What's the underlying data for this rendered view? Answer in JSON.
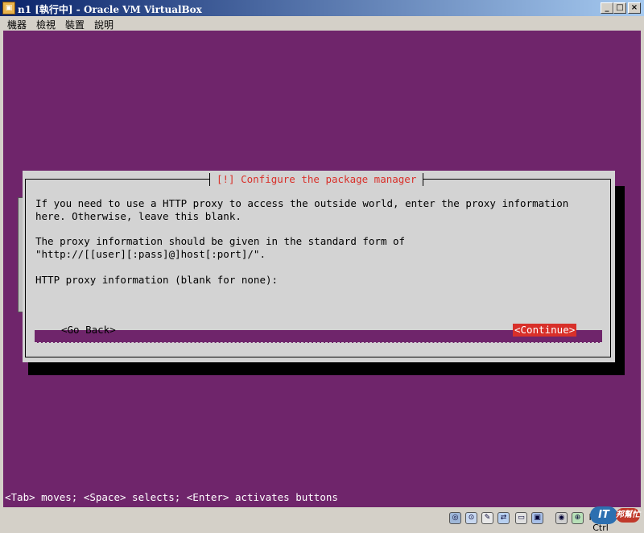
{
  "window": {
    "title": "n1 [執行中] - Oracle VM VirtualBox",
    "app_icon": "virtualbox-icon",
    "controls": {
      "minimize": "_",
      "maximize": "□",
      "close": "×"
    }
  },
  "menu": {
    "items": [
      "機器",
      "檢視",
      "裝置",
      "說明"
    ]
  },
  "dialog": {
    "title": "[!] Configure the package manager",
    "lines": [
      "If you need to use a HTTP proxy to access the outside world, enter the proxy information",
      "here. Otherwise, leave this blank.",
      "The proxy information should be given in the standard form of",
      "\"http://[[user][:pass]@]host[:port]/\".",
      "HTTP proxy information (blank for none):"
    ],
    "proxy_value": "",
    "go_back_label": "<Go Back>",
    "continue_label": "<Continue>"
  },
  "console": {
    "help_line": "<Tab> moves; <Space> selects; <Enter> activates buttons"
  },
  "statusbar": {
    "icons": [
      "hard-disk-icon",
      "optical-drive-icon",
      "usb-icon",
      "network-icon",
      "shared-folder-icon",
      "display-icon",
      "video-capture-icon",
      "mouse-integration-icon",
      "host-key-icon"
    ],
    "host_key": "Right Ctrl",
    "watermark_it": "IT",
    "watermark_text": "邦幫忙"
  },
  "colors": {
    "console_bg": "#6f256b",
    "dialog_bg": "#d3d3d3",
    "accent_red": "#d8302a"
  }
}
